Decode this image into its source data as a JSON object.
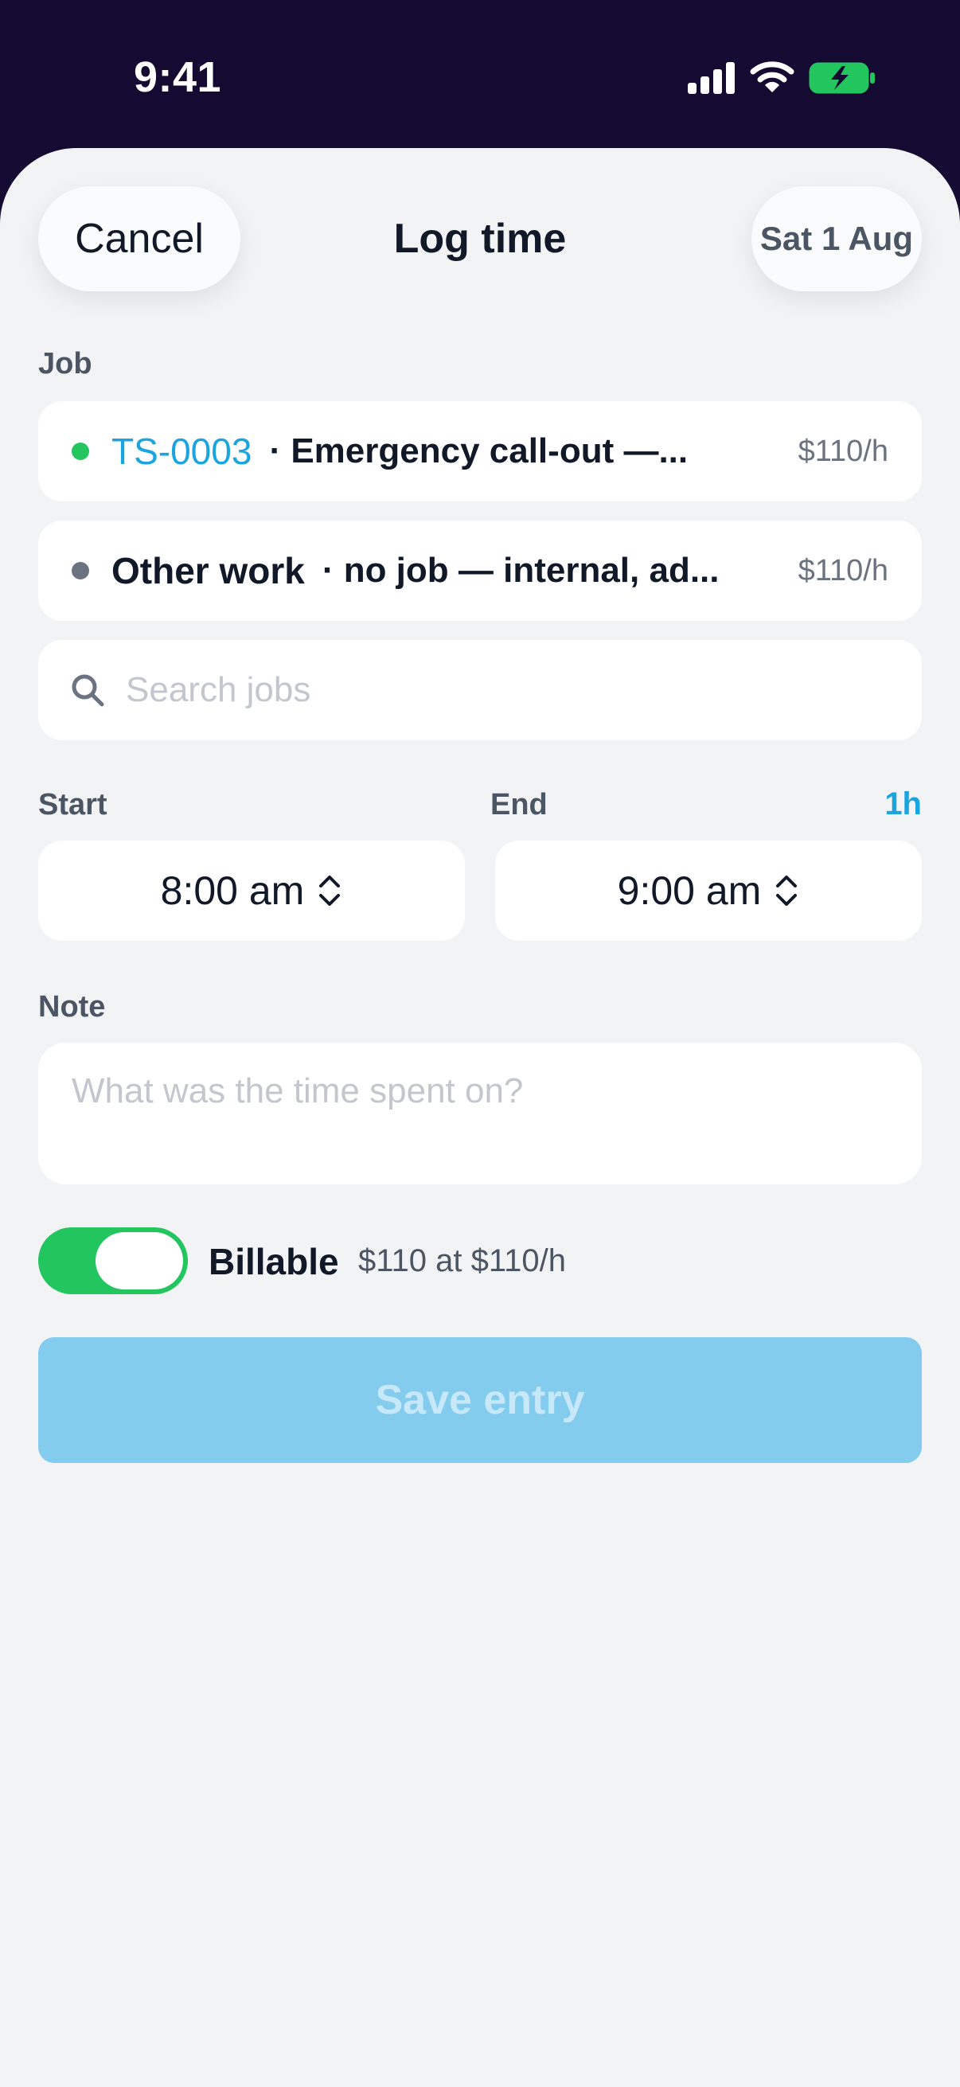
{
  "status_bar": {
    "time": "9:41"
  },
  "header": {
    "cancel_label": "Cancel",
    "title": "Log time",
    "date_label": "Sat 1 Aug"
  },
  "job_section": {
    "label": "Job",
    "options": [
      {
        "code": "TS-0003",
        "description": "· Emergency call-out —...",
        "rate": "$110/h",
        "dot_color": "#22c55e",
        "selected": true
      },
      {
        "name": "Other work",
        "description": "· no job — internal, ad...",
        "rate": "$110/h",
        "dot_color": "#6b7280",
        "selected": false
      }
    ],
    "search_placeholder": "Search jobs"
  },
  "time_section": {
    "start_label": "Start",
    "end_label": "End",
    "duration": "1h",
    "start_value": "8:00 am",
    "end_value": "9:00 am"
  },
  "note_section": {
    "label": "Note",
    "placeholder": "What was the time spent on?"
  },
  "billable": {
    "enabled": true,
    "label": "Billable",
    "amount_text": "$110 at $110/h"
  },
  "save_button": {
    "label": "Save entry",
    "enabled": false
  },
  "colors": {
    "accent": "#1aa5e0",
    "toggle_on": "#22c55e",
    "save_disabled": "#84ccee",
    "background": "#f2f3f5",
    "status_bar": "#150a32"
  },
  "icons": [
    "signal-icon",
    "wifi-icon",
    "battery-charging-icon",
    "search-icon",
    "chevron-up-down-icon"
  ]
}
